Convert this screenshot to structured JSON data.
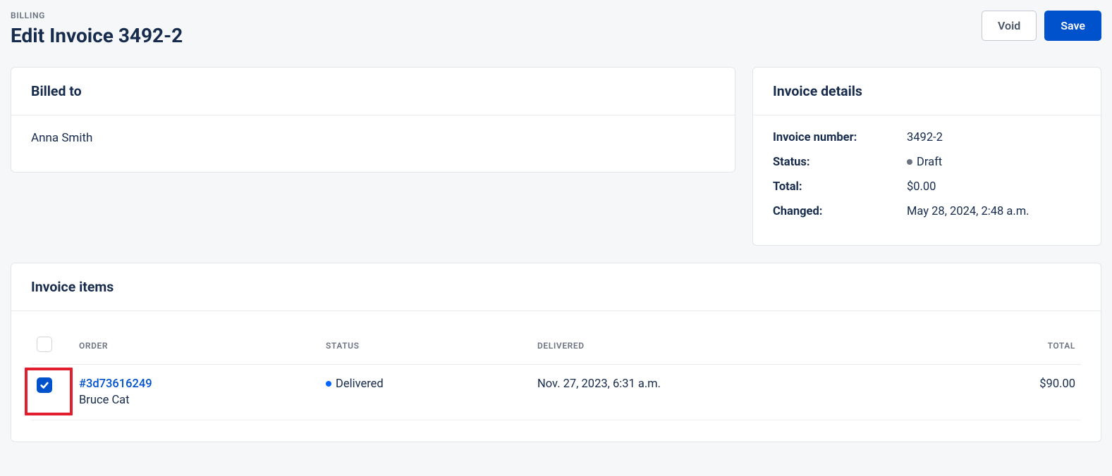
{
  "header": {
    "breadcrumb": "BILLING",
    "title": "Edit Invoice 3492-2",
    "void_label": "Void",
    "save_label": "Save"
  },
  "billed_to": {
    "card_title": "Billed to",
    "name": "Anna Smith"
  },
  "details": {
    "card_title": "Invoice details",
    "rows": {
      "invoice_number": {
        "label": "Invoice number:",
        "value": "3492-2"
      },
      "status": {
        "label": "Status:",
        "value": "Draft"
      },
      "total": {
        "label": "Total:",
        "value": "$0.00"
      },
      "changed": {
        "label": "Changed:",
        "value": "May 28, 2024, 2:48 a.m."
      }
    }
  },
  "items": {
    "card_title": "Invoice items",
    "columns": {
      "order": "ORDER",
      "status": "STATUS",
      "delivered": "DELIVERED",
      "total": "TOTAL"
    },
    "rows": [
      {
        "checked": true,
        "order_id": "#3d73616249",
        "customer": "Bruce Cat",
        "status": "Delivered",
        "delivered": "Nov. 27, 2023, 6:31 a.m.",
        "total": "$90.00"
      }
    ]
  }
}
